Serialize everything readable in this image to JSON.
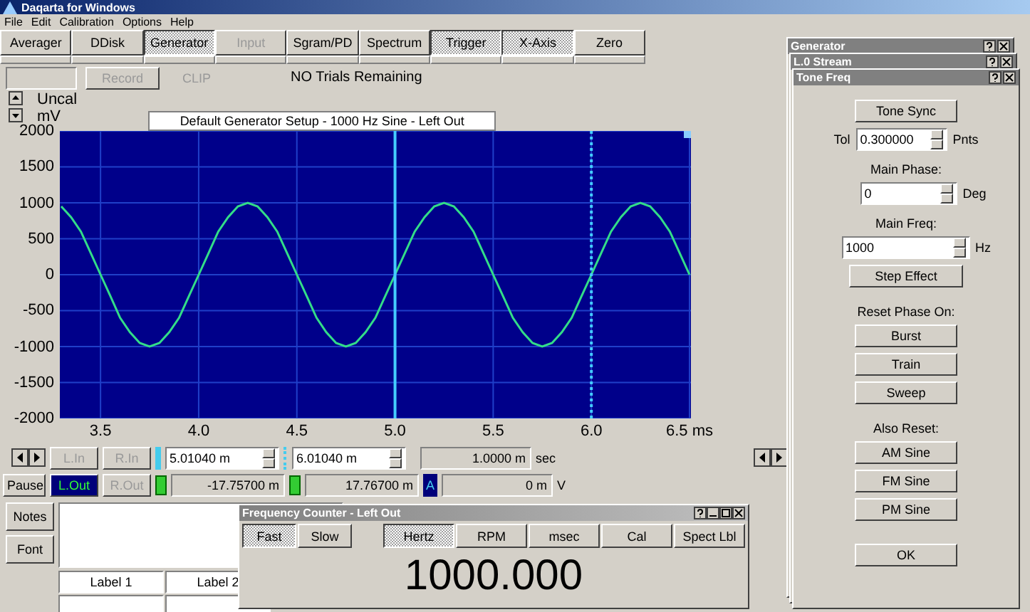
{
  "window": {
    "title": "Daqarta for Windows"
  },
  "menu": [
    "File",
    "Edit",
    "Calibration",
    "Options",
    "Help"
  ],
  "tabs": [
    {
      "label": "Averager",
      "on": false,
      "disabled": false
    },
    {
      "label": "DDisk",
      "on": false,
      "disabled": false
    },
    {
      "label": "Generator",
      "on": true,
      "disabled": false
    },
    {
      "label": "Input",
      "on": false,
      "disabled": true
    },
    {
      "label": "Sgram/PD",
      "on": false,
      "disabled": false
    },
    {
      "label": "Spectrum",
      "on": false,
      "disabled": false
    },
    {
      "label": "Trigger",
      "on": true,
      "disabled": false
    },
    {
      "label": "X-Axis",
      "on": true,
      "disabled": false
    },
    {
      "label": "Zero",
      "on": false,
      "disabled": false
    }
  ],
  "status_row": {
    "record": {
      "label": "Record",
      "disabled": true
    },
    "clip": "CLIP",
    "trials": "NO Trials Remaining"
  },
  "y_units": {
    "calibration": "Uncal",
    "unit": "mV"
  },
  "display_title": "Default Generator Setup - 1000 Hz Sine - Left Out",
  "chart_data": {
    "type": "line",
    "xlim": [
      3.3,
      6.5
    ],
    "ylim": [
      -2000,
      2000
    ],
    "xticks": [
      3.5,
      {
        "value": 4,
        "label": "4.0"
      },
      4.5,
      {
        "value": 5,
        "label": "5.0"
      },
      5.5,
      {
        "value": 6,
        "label": "6.0"
      },
      {
        "value": 6.5,
        "label": "6.5 ms"
      }
    ],
    "yticks": [
      2000,
      1500,
      1000,
      500,
      0,
      -500,
      -1000,
      -1500,
      -2000
    ],
    "x": [
      3.3,
      3.35,
      3.4,
      3.45,
      3.5,
      3.55,
      3.6,
      3.65,
      3.7,
      3.75,
      3.8,
      3.85,
      3.9,
      3.95,
      4.0,
      4.05,
      4.1,
      4.15,
      4.2,
      4.25,
      4.3,
      4.35,
      4.4,
      4.45,
      4.5,
      4.55,
      4.6,
      4.65,
      4.7,
      4.75,
      4.8,
      4.85,
      4.9,
      4.95,
      5.0,
      5.05,
      5.1,
      5.15,
      5.2,
      5.25,
      5.3,
      5.35,
      5.4,
      5.45,
      5.5,
      5.55,
      5.6,
      5.65,
      5.7,
      5.75,
      5.8,
      5.85,
      5.9,
      5.95,
      6.0,
      6.05,
      6.1,
      6.15,
      6.2,
      6.25,
      6.3,
      6.35,
      6.4,
      6.45,
      6.5
    ],
    "series": [
      {
        "color": "#33dd88",
        "values": [
          950,
          800,
          600,
          300,
          0,
          -300,
          -600,
          -800,
          -950,
          -1000,
          -950,
          -800,
          -600,
          -300,
          0,
          300,
          600,
          800,
          950,
          1000,
          950,
          800,
          600,
          300,
          0,
          -300,
          -600,
          -800,
          -950,
          -1000,
          -950,
          -800,
          -600,
          -300,
          0,
          300,
          600,
          800,
          950,
          1000,
          950,
          800,
          600,
          300,
          0,
          -300,
          -600,
          -800,
          -950,
          -1000,
          -950,
          -800,
          -600,
          -300,
          0,
          300,
          600,
          800,
          950,
          1000,
          950,
          800,
          600,
          300,
          0
        ]
      }
    ],
    "grid": true,
    "ref_lines": [
      {
        "axis": "x",
        "value": 5.0
      },
      {
        "axis": "x",
        "value": 6.0
      }
    ]
  },
  "cursor_rows": [
    {
      "channels": [
        {
          "label": "L.In",
          "selected": false
        },
        {
          "label": "R.In",
          "selected": false
        }
      ],
      "kind": "time",
      "c1": "5.01040 m",
      "c2": "6.01040 m",
      "delta": "1.0000 m",
      "unit": "sec"
    },
    {
      "button": "Pause",
      "channels": [
        {
          "label": "L.Out",
          "selected": true
        },
        {
          "label": "R.Out",
          "selected": false
        }
      ],
      "kind": "volt",
      "c1": "-17.75700 m",
      "c2": "17.76700 m",
      "delta_mark": "A",
      "delta": "0 m",
      "unit": "V"
    }
  ],
  "notes": {
    "buttons": [
      "Notes",
      "Font"
    ],
    "labels": [
      "Label 1",
      "Label 2"
    ]
  },
  "freq_counter": {
    "title": "Frequency Counter - Left Out",
    "speeds": [
      {
        "label": "Fast",
        "selected": true
      },
      {
        "label": "Slow",
        "selected": false
      }
    ],
    "units": [
      {
        "label": "Hertz",
        "selected": true
      },
      {
        "label": "RPM",
        "selected": false
      },
      {
        "label": "msec",
        "selected": false
      },
      {
        "label": "Cal",
        "selected": false
      },
      {
        "label": "Spect Lbl",
        "selected": false
      }
    ],
    "value": "1000.000"
  },
  "generator": {
    "windows": [
      "Generator",
      "L.0 Stream",
      "Tone Freq"
    ],
    "sync": "Tone Sync",
    "tol_label": "Tol",
    "tol": "0.300000",
    "tol_unit": "Pnts",
    "phase_label": "Main Phase:",
    "phase": "0",
    "phase_unit": "Deg",
    "freq_label": "Main Freq:",
    "freq": "1000",
    "freq_unit": "Hz",
    "step": "Step Effect",
    "reset_label": "Reset Phase On:",
    "reset": [
      "Burst",
      "Train",
      "Sweep"
    ],
    "also_label": "Also Reset:",
    "also": [
      "AM Sine",
      "FM Sine",
      "PM Sine"
    ],
    "ok": "OK"
  }
}
